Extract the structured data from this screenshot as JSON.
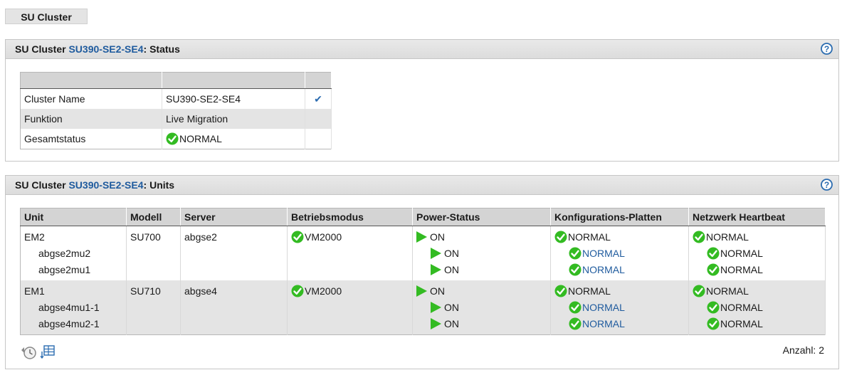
{
  "page_tab": "SU Cluster",
  "cluster_prefix": "SU Cluster",
  "cluster_name": "SU390-SE2-SE4",
  "status_panel": {
    "suffix": ": Status",
    "rows": [
      {
        "label": "Cluster Name",
        "value": "SU390-SE2-SE4"
      },
      {
        "label": "Funktion",
        "value": "Live Migration"
      },
      {
        "label": "Gesamtstatus",
        "value": "NORMAL"
      }
    ]
  },
  "units_panel": {
    "suffix": ": Units",
    "columns": [
      "Unit",
      "Modell",
      "Server",
      "Betriebsmodus",
      "Power-Status",
      "Konfigurations-Platten",
      "Netzwerk Heartbeat"
    ],
    "units": [
      {
        "unit": "EM2",
        "model": "SU700",
        "server": "abgse2",
        "mode": "VM2000",
        "power": "ON",
        "config": "NORMAL",
        "heartbeat": "NORMAL",
        "subunits": [
          {
            "name": "abgse2mu2",
            "power": "ON",
            "config": "NORMAL",
            "heartbeat": "NORMAL"
          },
          {
            "name": "abgse2mu1",
            "power": "ON",
            "config": "NORMAL",
            "heartbeat": "NORMAL"
          }
        ]
      },
      {
        "unit": "EM1",
        "model": "SU710",
        "server": "abgse4",
        "mode": "VM2000",
        "power": "ON",
        "config": "NORMAL",
        "heartbeat": "NORMAL",
        "subunits": [
          {
            "name": "abgse4mu1-1",
            "power": "ON",
            "config": "NORMAL",
            "heartbeat": "NORMAL"
          },
          {
            "name": "abgse4mu2-1",
            "power": "ON",
            "config": "NORMAL",
            "heartbeat": "NORMAL"
          }
        ]
      }
    ],
    "count_label": "Anzahl: 2"
  },
  "icons": [
    "help-icon",
    "ok-status-icon",
    "power-on-icon",
    "check-icon",
    "refresh-history-icon",
    "table-export-icon"
  ],
  "colors": {
    "link": "#1f5b9e",
    "ok_green": "#33bb22",
    "header_bg": "#dcdcdc"
  }
}
